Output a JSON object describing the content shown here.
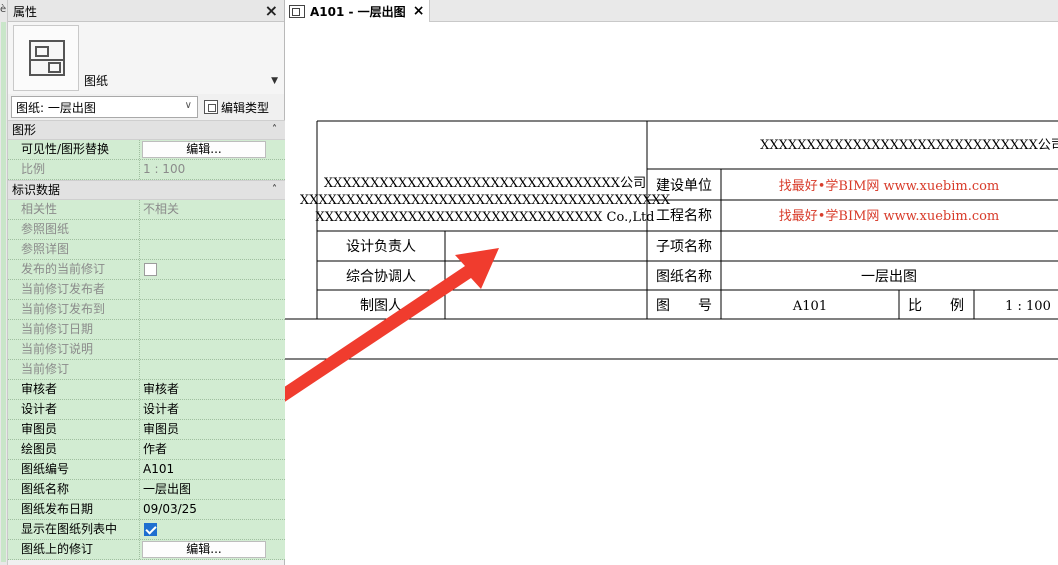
{
  "left_strip_mark": "è",
  "properties": {
    "title": "属性",
    "close": "×",
    "type_name": "图纸",
    "instance_select": "图纸: 一层出图",
    "edit_type_label": "编辑类型",
    "sections": [
      {
        "label": "图形",
        "rows": [
          {
            "key": "可见性/图形替换",
            "value": "编辑...",
            "kind": "button",
            "disabled": false
          },
          {
            "key": "比例",
            "value": "1 : 100",
            "kind": "text",
            "disabled": true
          }
        ]
      },
      {
        "label": "标识数据",
        "rows": [
          {
            "key": "相关性",
            "value": "不相关",
            "kind": "text",
            "disabled": true
          },
          {
            "key": "参照图纸",
            "value": "",
            "kind": "text",
            "disabled": true
          },
          {
            "key": "参照详图",
            "value": "",
            "kind": "text",
            "disabled": true
          },
          {
            "key": "发布的当前修订",
            "value": false,
            "kind": "checkbox",
            "disabled": true
          },
          {
            "key": "当前修订发布者",
            "value": "",
            "kind": "text",
            "disabled": true
          },
          {
            "key": "当前修订发布到",
            "value": "",
            "kind": "text",
            "disabled": true
          },
          {
            "key": "当前修订日期",
            "value": "",
            "kind": "text",
            "disabled": true
          },
          {
            "key": "当前修订说明",
            "value": "",
            "kind": "text",
            "disabled": true
          },
          {
            "key": "当前修订",
            "value": "",
            "kind": "text",
            "disabled": true
          },
          {
            "key": "审核者",
            "value": "审核者",
            "kind": "text",
            "disabled": false
          },
          {
            "key": "设计者",
            "value": "设计者",
            "kind": "text",
            "disabled": false
          },
          {
            "key": "审图员",
            "value": "审图员",
            "kind": "text",
            "disabled": false
          },
          {
            "key": "绘图员",
            "value": "作者",
            "kind": "text",
            "disabled": false
          },
          {
            "key": "图纸编号",
            "value": "A101",
            "kind": "text",
            "disabled": false
          },
          {
            "key": "图纸名称",
            "value": "一层出图",
            "kind": "text",
            "disabled": false
          },
          {
            "key": "图纸发布日期",
            "value": "09/03/25",
            "kind": "text",
            "disabled": false
          },
          {
            "key": "显示在图纸列表中",
            "value": true,
            "kind": "checkbox",
            "disabled": false
          },
          {
            "key": "图纸上的修订",
            "value": "编辑...",
            "kind": "button",
            "disabled": false
          }
        ]
      }
    ]
  },
  "view_tab": {
    "label": "A101 - 一层出图",
    "close": "×"
  },
  "title_block": {
    "company_line1": "XXXXXXXXXXXXXXXXXXXXXXXXXXXXXXXX公司",
    "company_line2": "XXXXXXXXXXXXXXXXXXXXXXXXXXXXXXXXXXXXXXXX",
    "company_line3": "XXXXXXXXXXXXXXXXXXXXXXXXXXXXXXX Co.,Ltd",
    "left_labels": [
      "设计负责人",
      "综合协调人",
      "制图人"
    ],
    "company_right": "XXXXXXXXXXXXXXXXXXXXXXXXXXXXXX公司",
    "right_rows": [
      {
        "label": "建设单位",
        "value": "找最好•学BIM网 www.xuebim.com"
      },
      {
        "label": "工程名称",
        "value": "找最好•学BIM网 www.xuebim.com"
      },
      {
        "label": "子项名称",
        "value": ""
      },
      {
        "label": "图纸名称",
        "value": "一层出图"
      }
    ],
    "number_label": "图　　号",
    "number_value": "A101",
    "scale_label": "比　　例",
    "scale_value": "1 : 100",
    "highlight_color": "#d83b2a",
    "arrow_color": "#f03c2e"
  }
}
